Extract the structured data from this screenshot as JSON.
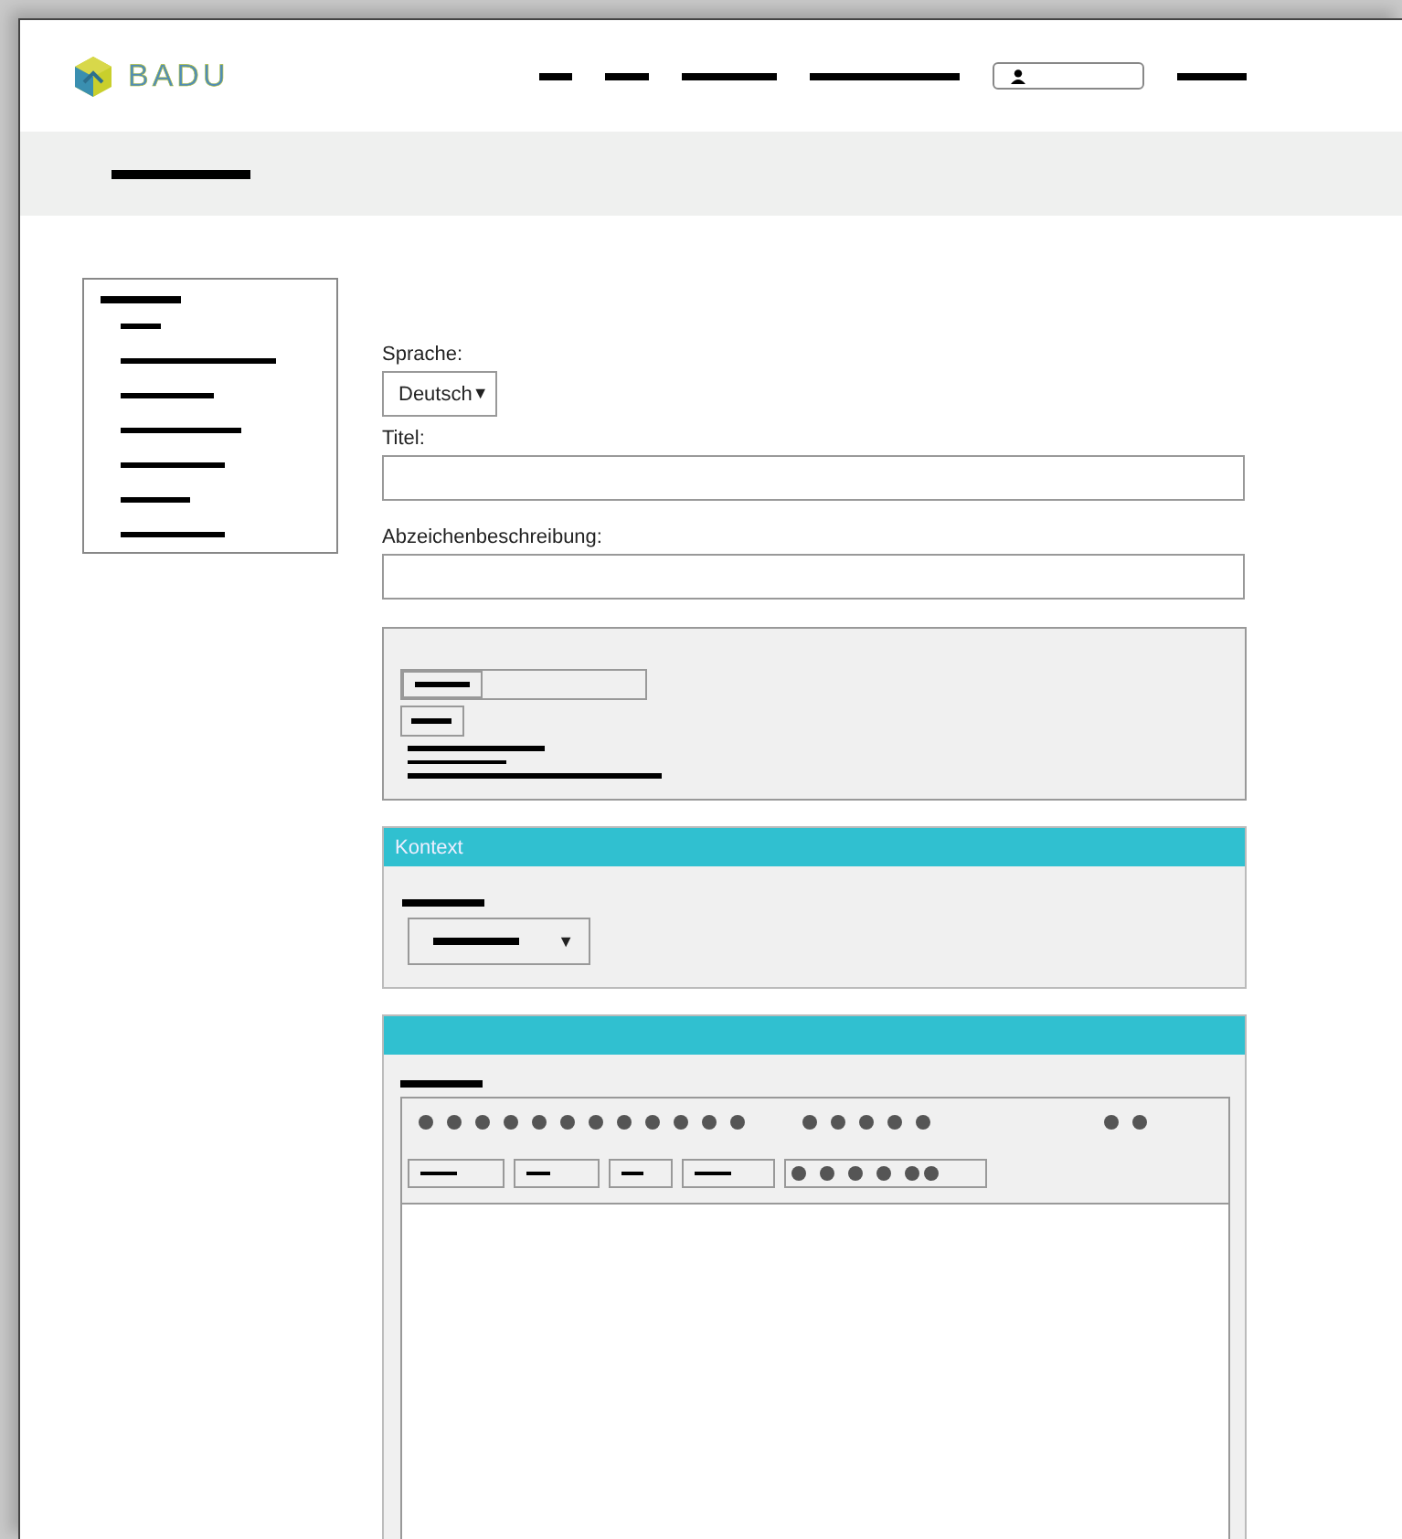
{
  "header": {
    "logo_text": "BADU"
  },
  "form": {
    "language_label": "Sprache:",
    "language_value": "Deutsch",
    "language_caret": "▼",
    "title_label": "Titel:",
    "description_label": "Abzeichenbeschreibung:"
  },
  "context_panel": {
    "title": "Kontext",
    "select_caret": "▼"
  }
}
